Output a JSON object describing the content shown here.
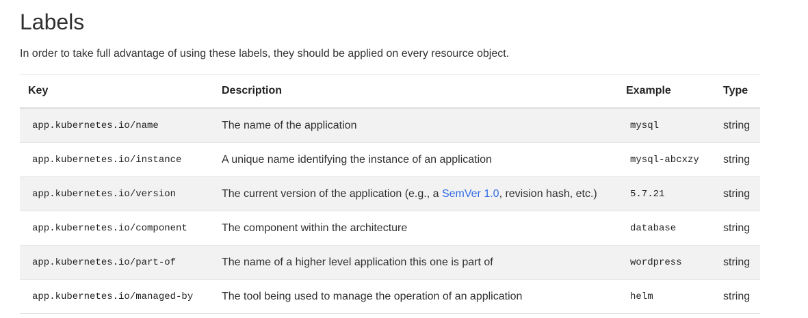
{
  "heading": "Labels",
  "intro": "In order to take full advantage of using these labels, they should be applied on every resource object.",
  "table": {
    "headers": {
      "key": "Key",
      "description": "Description",
      "example": "Example",
      "type": "Type"
    },
    "rows": [
      {
        "key": "app.kubernetes.io/name",
        "description": "The name of the application",
        "example": "mysql",
        "type": "string"
      },
      {
        "key": "app.kubernetes.io/instance",
        "description": "A unique name identifying the instance of an application",
        "example": "mysql-abcxzy",
        "type": "string"
      },
      {
        "key": "app.kubernetes.io/version",
        "description_before": "The current version of the application (e.g., a ",
        "description_link": "SemVer 1.0",
        "description_after": ", revision hash, etc.)",
        "example": "5.7.21",
        "type": "string"
      },
      {
        "key": "app.kubernetes.io/component",
        "description": "The component within the architecture",
        "example": "database",
        "type": "string"
      },
      {
        "key": "app.kubernetes.io/part-of",
        "description": "The name of a higher level application this one is part of",
        "example": "wordpress",
        "type": "string"
      },
      {
        "key": "app.kubernetes.io/managed-by",
        "description": "The tool being used to manage the operation of an application",
        "example": "helm",
        "type": "string"
      }
    ]
  },
  "colors": {
    "link": "#326ce5",
    "row_stripe": "#f2f2f2"
  }
}
